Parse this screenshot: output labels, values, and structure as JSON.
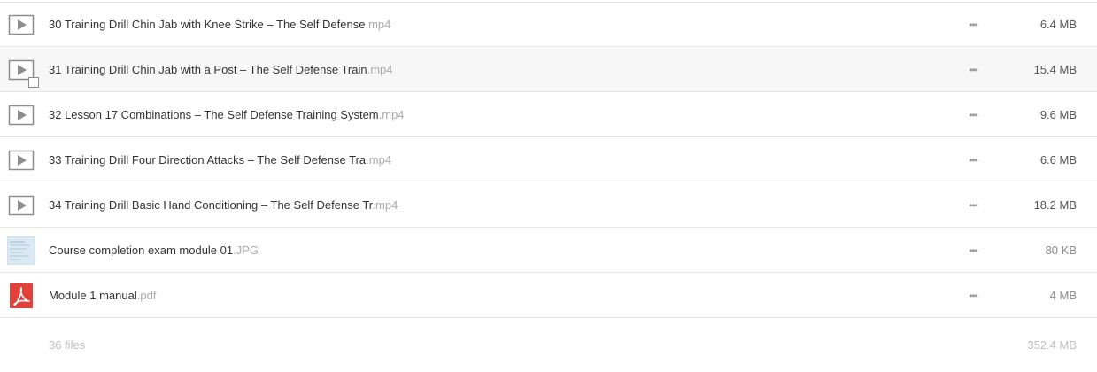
{
  "files": [
    {
      "icon": "video-play-icon",
      "name": "30 Training Drill Chin Jab with Knee Strike – The Self Defense",
      "ext": ".mp4",
      "size": "6.4 MB"
    },
    {
      "icon": "video-play-icon",
      "name": "31 Training Drill Chin Jab with a Post – The Self Defense Train",
      "ext": ".mp4",
      "size": "15.4 MB"
    },
    {
      "icon": "video-play-icon",
      "name": "32 Lesson 17 Combinations – The Self Defense Training System",
      "ext": ".mp4",
      "size": "9.6 MB"
    },
    {
      "icon": "video-play-icon",
      "name": "33 Training Drill Four Direction Attacks – The Self Defense Tra",
      "ext": ".mp4",
      "size": "6.6 MB"
    },
    {
      "icon": "video-play-icon",
      "name": "34 Training Drill Basic Hand Conditioning – The Self Defense Tr",
      "ext": ".mp4",
      "size": "18.2 MB"
    },
    {
      "icon": "image-thumbnail-icon",
      "name": "Course completion exam module 01",
      "ext": ".JPG",
      "size": "80 KB"
    },
    {
      "icon": "pdf-icon",
      "name": "Module 1 manual",
      "ext": ".pdf",
      "size": "4 MB"
    }
  ],
  "more_label": "•••",
  "footer": {
    "count": "36 files",
    "total": "352.4 MB"
  },
  "colors": {
    "pdf_red": "#e2413a",
    "divider": "#e6e6e6",
    "hover_row": "#f7f7f7"
  }
}
